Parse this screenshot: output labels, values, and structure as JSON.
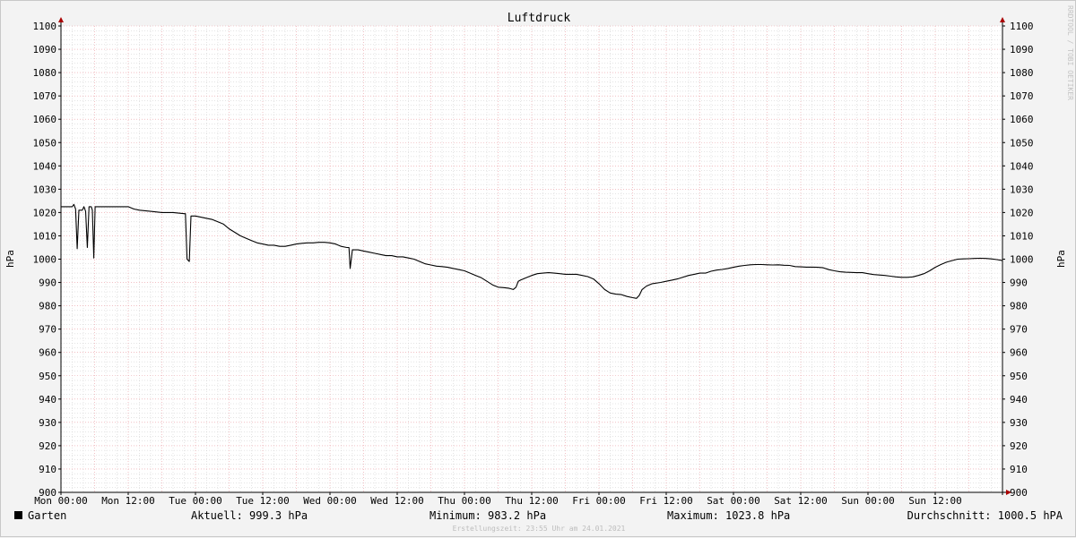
{
  "chart_data": {
    "type": "line",
    "title": "Luftdruck",
    "ylabel": "hPa",
    "ylabel_right": "hPa",
    "ylim": [
      900,
      1100
    ],
    "yticks": [
      900,
      910,
      920,
      930,
      940,
      950,
      960,
      970,
      980,
      990,
      1000,
      1010,
      1020,
      1030,
      1040,
      1050,
      1060,
      1070,
      1080,
      1090,
      1100
    ],
    "xlim": [
      0,
      168
    ],
    "xticks": [
      {
        "x": 0,
        "label": "Mon 00:00"
      },
      {
        "x": 12,
        "label": "Mon 12:00"
      },
      {
        "x": 24,
        "label": "Tue 00:00"
      },
      {
        "x": 36,
        "label": "Tue 12:00"
      },
      {
        "x": 48,
        "label": "Wed 00:00"
      },
      {
        "x": 60,
        "label": "Wed 12:00"
      },
      {
        "x": 72,
        "label": "Thu 00:00"
      },
      {
        "x": 84,
        "label": "Thu 12:00"
      },
      {
        "x": 96,
        "label": "Fri 00:00"
      },
      {
        "x": 108,
        "label": "Fri 12:00"
      },
      {
        "x": 120,
        "label": "Sat 00:00"
      },
      {
        "x": 132,
        "label": "Sat 12:00"
      },
      {
        "x": 144,
        "label": "Sun 00:00"
      },
      {
        "x": 156,
        "label": "Sun 12:00"
      }
    ],
    "grid": true,
    "series": [
      {
        "name": "Garten",
        "color": "#000000",
        "points": [
          [
            0,
            1022.5
          ],
          [
            2,
            1022.5
          ],
          [
            2.3,
            1023.5
          ],
          [
            2.6,
            1021.5
          ],
          [
            2.9,
            1004.5
          ],
          [
            3.2,
            1021
          ],
          [
            3.8,
            1021
          ],
          [
            4.1,
            1022.5
          ],
          [
            4.4,
            1020.5
          ],
          [
            4.7,
            1005
          ],
          [
            5,
            1022.5
          ],
          [
            5.4,
            1022.5
          ],
          [
            5.6,
            1021
          ],
          [
            5.85,
            1000.5
          ],
          [
            6.1,
            1022.5
          ],
          [
            8,
            1022.5
          ],
          [
            10,
            1022.5
          ],
          [
            12,
            1022.5
          ],
          [
            13,
            1021.5
          ],
          [
            14,
            1021
          ],
          [
            16,
            1020.5
          ],
          [
            18,
            1020
          ],
          [
            20,
            1020
          ],
          [
            22,
            1019.5
          ],
          [
            22.2,
            1019.5
          ],
          [
            22.5,
            1000
          ],
          [
            22.9,
            999
          ],
          [
            23.2,
            1018.5
          ],
          [
            24,
            1018.5
          ],
          [
            26,
            1017.5
          ],
          [
            27,
            1017
          ],
          [
            28,
            1016
          ],
          [
            29,
            1015
          ],
          [
            30,
            1013
          ],
          [
            31,
            1011.5
          ],
          [
            32,
            1010
          ],
          [
            33,
            1009
          ],
          [
            34,
            1008
          ],
          [
            35,
            1007
          ],
          [
            36,
            1006.5
          ],
          [
            37,
            1006
          ],
          [
            38,
            1006
          ],
          [
            39,
            1005.5
          ],
          [
            40,
            1005.5
          ],
          [
            41,
            1006
          ],
          [
            42,
            1006.5
          ],
          [
            43,
            1006.8
          ],
          [
            44,
            1007
          ],
          [
            45,
            1007
          ],
          [
            46,
            1007.2
          ],
          [
            47,
            1007.2
          ],
          [
            48,
            1007
          ],
          [
            49,
            1006.5
          ],
          [
            50,
            1005.5
          ],
          [
            51,
            1005
          ],
          [
            51.4,
            1005
          ],
          [
            51.6,
            996
          ],
          [
            52,
            1004
          ],
          [
            53,
            1004
          ],
          [
            54,
            1003.5
          ],
          [
            55,
            1003
          ],
          [
            56,
            1002.5
          ],
          [
            57,
            1002
          ],
          [
            58,
            1001.5
          ],
          [
            59,
            1001.5
          ],
          [
            60,
            1001
          ],
          [
            61,
            1001
          ],
          [
            62,
            1000.5
          ],
          [
            63,
            1000
          ],
          [
            64,
            999
          ],
          [
            65,
            998
          ],
          [
            66,
            997.5
          ],
          [
            67,
            997
          ],
          [
            68,
            996.8
          ],
          [
            69,
            996.5
          ],
          [
            70,
            996
          ],
          [
            71,
            995.5
          ],
          [
            72,
            995
          ],
          [
            73,
            994
          ],
          [
            74,
            993
          ],
          [
            75,
            992
          ],
          [
            76,
            990.5
          ],
          [
            77,
            989
          ],
          [
            78,
            988
          ],
          [
            79,
            987.8
          ],
          [
            80,
            987.5
          ],
          [
            80.7,
            987
          ],
          [
            81.2,
            988
          ],
          [
            81.6,
            990.5
          ],
          [
            82,
            991
          ],
          [
            83,
            992
          ],
          [
            84,
            993
          ],
          [
            85,
            993.8
          ],
          [
            86,
            994
          ],
          [
            87,
            994.2
          ],
          [
            88,
            994
          ],
          [
            89,
            993.8
          ],
          [
            90,
            993.5
          ],
          [
            91,
            993.5
          ],
          [
            92,
            993.5
          ],
          [
            93,
            993
          ],
          [
            94,
            992.5
          ],
          [
            95,
            991.5
          ],
          [
            96,
            989.5
          ],
          [
            97,
            987
          ],
          [
            98,
            985.5
          ],
          [
            99,
            985
          ],
          [
            100,
            984.8
          ],
          [
            101,
            984
          ],
          [
            102,
            983.5
          ],
          [
            102.7,
            983.2
          ],
          [
            103.2,
            984.5
          ],
          [
            103.7,
            987
          ],
          [
            104.5,
            988.5
          ],
          [
            105.5,
            989.5
          ],
          [
            107,
            990
          ],
          [
            108,
            990.5
          ],
          [
            109,
            991
          ],
          [
            110,
            991.5
          ],
          [
            111,
            992.3
          ],
          [
            112,
            993
          ],
          [
            113,
            993.5
          ],
          [
            114,
            994
          ],
          [
            115,
            994
          ],
          [
            116,
            994.8
          ],
          [
            117,
            995.3
          ],
          [
            118,
            995.6
          ],
          [
            119,
            996
          ],
          [
            120,
            996.5
          ],
          [
            121,
            997
          ],
          [
            122,
            997.3
          ],
          [
            123,
            997.6
          ],
          [
            124,
            997.7
          ],
          [
            125,
            997.7
          ],
          [
            126,
            997.6
          ],
          [
            127,
            997.5
          ],
          [
            128,
            997.6
          ],
          [
            129,
            997.4
          ],
          [
            130,
            997.3
          ],
          [
            131,
            996.8
          ],
          [
            132,
            996.7
          ],
          [
            133,
            996.6
          ],
          [
            134,
            996.6
          ],
          [
            135,
            996.5
          ],
          [
            136,
            996.3
          ],
          [
            137,
            995.5
          ],
          [
            138,
            995
          ],
          [
            139,
            994.6
          ],
          [
            140,
            994.4
          ],
          [
            141,
            994.3
          ],
          [
            142,
            994.2
          ],
          [
            143,
            994.2
          ],
          [
            144,
            993.8
          ],
          [
            145,
            993.4
          ],
          [
            146,
            993.2
          ],
          [
            147,
            993
          ],
          [
            148,
            992.7
          ],
          [
            149,
            992.4
          ],
          [
            150,
            992.2
          ],
          [
            151,
            992.2
          ],
          [
            152,
            992.4
          ],
          [
            153,
            993
          ],
          [
            154,
            993.8
          ],
          [
            155,
            995
          ],
          [
            156,
            996.5
          ],
          [
            157,
            997.7
          ],
          [
            158,
            998.7
          ],
          [
            159,
            999.4
          ],
          [
            160,
            1000
          ],
          [
            161,
            1000.1
          ],
          [
            162,
            1000.2
          ],
          [
            163,
            1000.3
          ],
          [
            164,
            1000.4
          ],
          [
            165,
            1000.3
          ],
          [
            166,
            1000.1
          ],
          [
            167,
            999.8
          ],
          [
            168,
            999.4
          ]
        ]
      }
    ]
  },
  "legend": {
    "series_name": "Garten",
    "swatch_color": "#000000",
    "current": "Aktuell: 999.3 hPa",
    "minimum": "Minimum: 983.2 hPa",
    "maximum": "Maximum: 1023.8 hPa",
    "average": "Durchschnitt: 1000.5 hPA"
  },
  "footer": "Erstellungszeit: 23:55 Uhr am 24.01.2021",
  "watermark": "RRDTOOL / TOBI OETIKER",
  "colors": {
    "background": "#f3f3f3",
    "plot_background": "#ffffff",
    "major_grid": "#ea9ba1",
    "minor_grid": "#c9c9c9",
    "axis_arrow": "#aa0000"
  }
}
